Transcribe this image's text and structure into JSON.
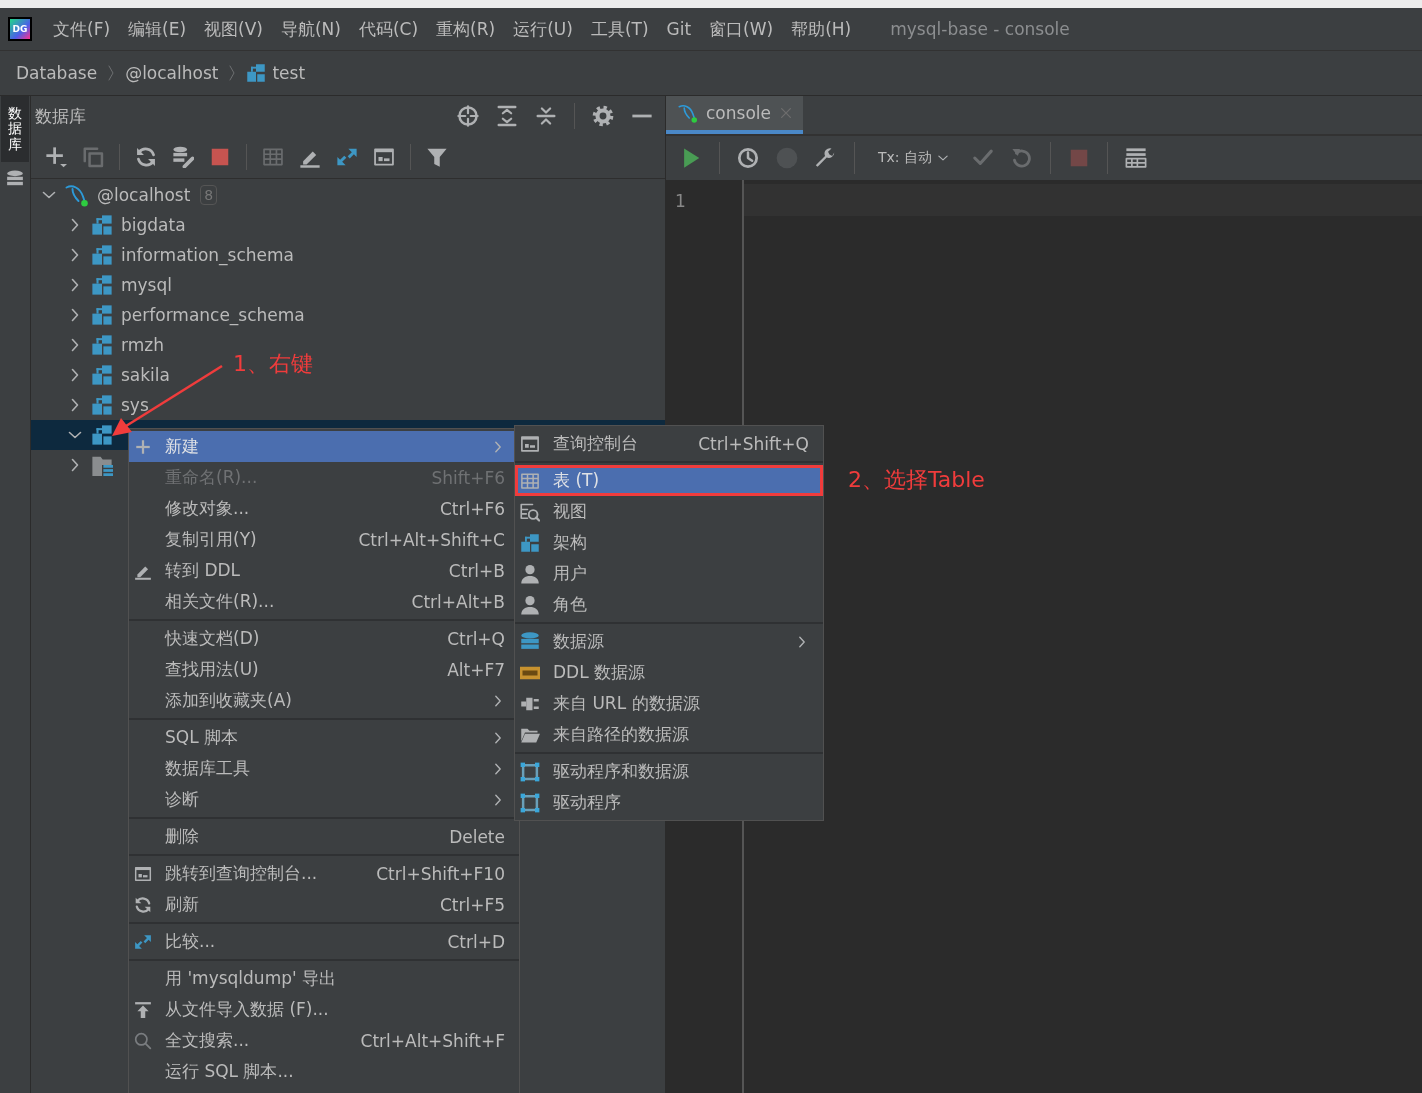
{
  "app_logo": {
    "text": "DG"
  },
  "menu_bar": {
    "items": [
      "文件(F)",
      "编辑(E)",
      "视图(V)",
      "导航(N)",
      "代码(C)",
      "重构(R)",
      "运行(U)",
      "工具(T)",
      "Git",
      "窗口(W)",
      "帮助(H)"
    ],
    "title": "mysql-base - console"
  },
  "breadcrumb": [
    {
      "label": "Database",
      "kind": "plain"
    },
    {
      "label": "@localhost",
      "kind": "plain"
    },
    {
      "label": "test",
      "kind": "schema"
    }
  ],
  "tool_strip": {
    "tab": "数据库",
    "selected": true
  },
  "db_panel": {
    "title": "数据库",
    "header_actions": [
      {
        "kind": "locate"
      },
      {
        "kind": "expand"
      },
      {
        "kind": "collapse"
      },
      {
        "kind": "sep"
      },
      {
        "kind": "gear"
      },
      {
        "kind": "minimize"
      }
    ],
    "toolbar": [
      {
        "kind": "add",
        "disabled": false
      },
      {
        "kind": "copy",
        "disabled": true
      },
      {
        "kind": "sep"
      },
      {
        "kind": "refresh",
        "disabled": false
      },
      {
        "kind": "dbtool",
        "disabled": false
      },
      {
        "kind": "stop",
        "disabled": false
      },
      {
        "kind": "sep"
      },
      {
        "kind": "grid",
        "disabled": true
      },
      {
        "kind": "pencil",
        "disabled": false
      },
      {
        "kind": "compare",
        "disabled": false
      },
      {
        "kind": "ql",
        "disabled": false
      },
      {
        "kind": "sep"
      },
      {
        "kind": "filter",
        "disabled": false
      }
    ],
    "tree": {
      "label": "@localhost",
      "count": "8",
      "expanded": true,
      "children": [
        {
          "label": "bigdata",
          "kind": "schema",
          "expanded": false,
          "selected": false
        },
        {
          "label": "information_schema",
          "kind": "schema",
          "expanded": false,
          "selected": false
        },
        {
          "label": "mysql",
          "kind": "schema",
          "expanded": false,
          "selected": false
        },
        {
          "label": "performance_schema",
          "kind": "schema",
          "expanded": false,
          "selected": false
        },
        {
          "label": "rmzh",
          "kind": "schema",
          "expanded": false,
          "selected": false
        },
        {
          "label": "sakila",
          "kind": "schema",
          "expanded": false,
          "selected": false
        },
        {
          "label": "sys",
          "kind": "schema",
          "expanded": false,
          "selected": false
        },
        {
          "kind": "schema",
          "expanded": true,
          "selected": true
        },
        {
          "kind": "folder",
          "expanded": false,
          "selected": false
        }
      ]
    }
  },
  "editor": {
    "tab": {
      "label": "console",
      "selected": true
    },
    "toolbar": [
      {
        "kind": "play",
        "disabled": false
      },
      {
        "kind": "sep"
      },
      {
        "kind": "clock",
        "disabled": false
      },
      {
        "kind": "pcircle",
        "disabled": true
      },
      {
        "kind": "wrench",
        "disabled": false
      },
      {
        "kind": "sep"
      },
      {
        "kind": "tx"
      },
      {
        "kind": "check",
        "disabled": true
      },
      {
        "kind": "undo",
        "disabled": true
      },
      {
        "kind": "sep"
      },
      {
        "kind": "stop",
        "disabled": true
      },
      {
        "kind": "sep"
      },
      {
        "kind": "tableview",
        "disabled": false
      }
    ],
    "tx_label": "Tx: 自动",
    "line_numbers": [
      "1"
    ]
  },
  "context_menu": {
    "groups": [
      [
        {
          "label": "新建",
          "kind": "plus",
          "submenu": true,
          "selected": true,
          "disabled": false
        },
        {
          "label": "重命名(R)...",
          "kind": "plain",
          "shortcut": "Shift+F6",
          "submenu": false,
          "selected": false,
          "disabled": true
        },
        {
          "label": "修改对象...",
          "kind": "plain",
          "shortcut": "Ctrl+F6",
          "submenu": false,
          "selected": false,
          "disabled": false
        },
        {
          "label": "复制引用(Y)",
          "kind": "plain",
          "shortcut": "Ctrl+Alt+Shift+C",
          "submenu": false,
          "selected": false,
          "disabled": false
        },
        {
          "label": "转到 DDL",
          "kind": "pencil",
          "shortcut": "Ctrl+B",
          "submenu": false,
          "selected": false,
          "disabled": false
        },
        {
          "label": "相关文件(R)...",
          "kind": "plain",
          "shortcut": "Ctrl+Alt+B",
          "submenu": false,
          "selected": false,
          "disabled": false
        }
      ],
      [
        {
          "label": "快速文档(D)",
          "kind": "plain",
          "shortcut": "Ctrl+Q",
          "submenu": false,
          "selected": false,
          "disabled": false
        },
        {
          "label": "查找用法(U)",
          "kind": "plain",
          "shortcut": "Alt+F7",
          "submenu": false,
          "selected": false,
          "disabled": false
        },
        {
          "label": "添加到收藏夹(A)",
          "kind": "plain",
          "submenu": true,
          "selected": false,
          "disabled": false
        }
      ],
      [
        {
          "label": "SQL 脚本",
          "kind": "plain",
          "submenu": true,
          "selected": false,
          "disabled": false
        },
        {
          "label": "数据库工具",
          "kind": "plain",
          "submenu": true,
          "selected": false,
          "disabled": false
        },
        {
          "label": "诊断",
          "kind": "plain",
          "submenu": true,
          "selected": false,
          "disabled": false
        }
      ],
      [
        {
          "label": "删除",
          "kind": "plain",
          "shortcut": "Delete",
          "submenu": false,
          "selected": false,
          "disabled": false
        }
      ],
      [
        {
          "label": "跳转到查询控制台...",
          "kind": "ql",
          "shortcut": "Ctrl+Shift+F10",
          "submenu": false,
          "selected": false,
          "disabled": false
        },
        {
          "label": "刷新",
          "kind": "refresh",
          "shortcut": "Ctrl+F5",
          "submenu": false,
          "selected": false,
          "disabled": false
        }
      ],
      [
        {
          "label": "比较...",
          "kind": "compare",
          "shortcut": "Ctrl+D",
          "submenu": false,
          "selected": false,
          "disabled": false
        }
      ],
      [
        {
          "label": "用 'mysqldump' 导出",
          "kind": "plain",
          "submenu": false,
          "selected": false,
          "disabled": false
        },
        {
          "label": "从文件导入数据 (F)...",
          "kind": "import",
          "submenu": false,
          "selected": false,
          "disabled": false
        },
        {
          "label": "全文搜索...",
          "kind": "search",
          "shortcut": "Ctrl+Alt+Shift+F",
          "submenu": false,
          "selected": false,
          "disabled": false
        },
        {
          "label": "运行 SQL 脚本...",
          "kind": "plain",
          "submenu": false,
          "selected": false,
          "disabled": false
        }
      ]
    ]
  },
  "submenu": {
    "groups": [
      [
        {
          "label": "查询控制台",
          "kind": "ql",
          "shortcut": "Ctrl+Shift+Q",
          "submenu": false,
          "selected": false
        }
      ],
      [
        {
          "label": "表 (T)",
          "kind": "grid",
          "submenu": false,
          "selected": true
        },
        {
          "label": "视图",
          "kind": "view",
          "submenu": false,
          "selected": false
        },
        {
          "label": "架构",
          "kind": "schema",
          "submenu": false,
          "selected": false
        },
        {
          "label": "用户",
          "kind": "user",
          "submenu": false,
          "selected": false
        },
        {
          "label": "角色",
          "kind": "user",
          "submenu": false,
          "selected": false
        }
      ],
      [
        {
          "label": "数据源",
          "kind": "database",
          "submenu": true,
          "selected": false
        },
        {
          "label": "DDL 数据源",
          "kind": "ddl",
          "submenu": false,
          "selected": false
        },
        {
          "label": "来自 URL 的数据源",
          "kind": "plug",
          "submenu": false,
          "selected": false
        },
        {
          "label": "来自路径的数据源",
          "kind": "folderopen",
          "submenu": false,
          "selected": false
        }
      ],
      [
        {
          "label": "驱动程序和数据源",
          "kind": "driver",
          "submenu": false,
          "selected": false
        },
        {
          "label": "驱动程序",
          "kind": "driver",
          "submenu": false,
          "selected": false
        }
      ]
    ]
  },
  "annotations": [
    {
      "text": "1、右键"
    },
    {
      "text": "2、选择Table"
    }
  ]
}
